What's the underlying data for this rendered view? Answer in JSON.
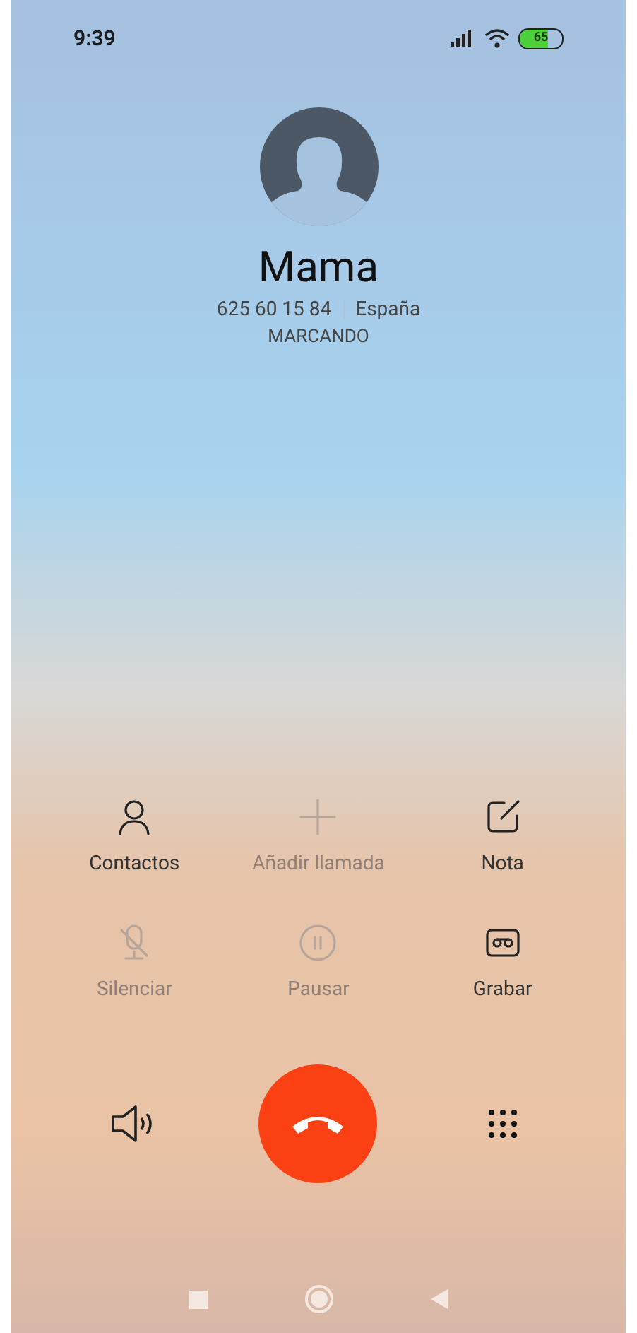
{
  "status_bar": {
    "time": "9:39",
    "battery": {
      "text": "65",
      "level": 0.65
    }
  },
  "contact": {
    "name": "Mama",
    "number": "625 60 15 84",
    "location": "España",
    "status": "MARCANDO"
  },
  "actions": [
    {
      "kind": "contacts",
      "label": "Contactos",
      "disabled": false
    },
    {
      "kind": "add",
      "label": "Añadir llamada",
      "disabled": true
    },
    {
      "kind": "note",
      "label": "Nota",
      "disabled": false
    },
    {
      "kind": "mute",
      "label": "Silenciar",
      "disabled": true
    },
    {
      "kind": "pause",
      "label": "Pausar",
      "disabled": true
    },
    {
      "kind": "record",
      "label": "Grabar",
      "disabled": false
    }
  ],
  "controls": [
    {
      "kind": "speaker"
    },
    {
      "kind": "end_call"
    },
    {
      "kind": "keypad"
    }
  ],
  "nav_bar": [
    {
      "kind": "recents"
    },
    {
      "kind": "home"
    },
    {
      "kind": "back"
    }
  ]
}
